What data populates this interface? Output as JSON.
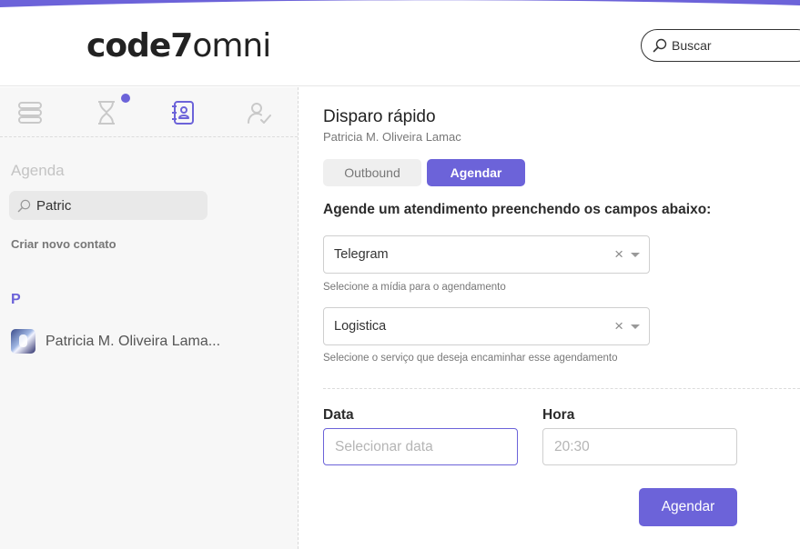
{
  "brand": {
    "logo_bold": "code7",
    "logo_light": "omni",
    "accent": "#6c63d9"
  },
  "header": {
    "search_placeholder": "Buscar",
    "search_icon": "search-icon"
  },
  "sidebar": {
    "tabs": [
      {
        "icon": "list-stack-icon",
        "active": false
      },
      {
        "icon": "hourglass-icon",
        "active": false,
        "notification": true
      },
      {
        "icon": "contacts-book-icon",
        "active": true
      },
      {
        "icon": "user-check-icon",
        "active": false
      }
    ],
    "section_title": "Agenda",
    "search_value": "Patric",
    "new_contact": "Criar novo contato",
    "group_letter": "P",
    "contacts": [
      {
        "name": "Patricia M. Oliveira Lama..."
      }
    ]
  },
  "main": {
    "title": "Disparo rápido",
    "subtitle": "Patricia M. Oliveira Lamac",
    "tabs": {
      "outbound": "Outbound",
      "agendar": "Agendar",
      "active": "agendar"
    },
    "instruction": "Agende um atendimento preenchendo os campos abaixo:",
    "media_select": {
      "value": "Telegram",
      "help": "Selecione a mídia para o agendamento"
    },
    "service_select": {
      "value": "Logistica",
      "help": "Selecione o serviço que deseja encaminhar esse agendamento"
    },
    "date": {
      "label": "Data",
      "placeholder": "Selecionar data"
    },
    "time": {
      "label": "Hora",
      "placeholder": "20:30"
    },
    "submit_label": "Agendar"
  }
}
